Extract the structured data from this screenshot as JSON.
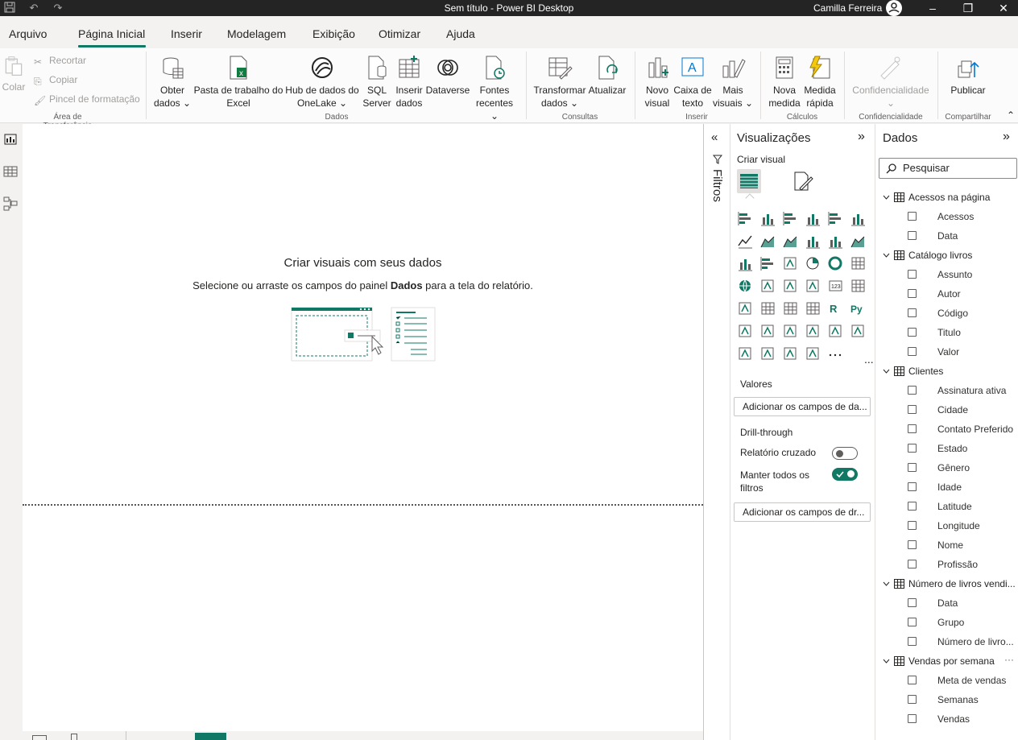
{
  "window": {
    "title": "Sem título - Power BI Desktop",
    "user": "Camilla Ferreira"
  },
  "menu": [
    "Arquivo",
    "Página Inicial",
    "Inserir",
    "Modelagem",
    "Exibição",
    "Otimizar",
    "Ajuda"
  ],
  "ribbon": {
    "clipboard": {
      "paste": "Colar",
      "cut": "Recortar",
      "copy": "Copiar",
      "format_painter": "Pincel de formatação",
      "label": "Área de Transferência"
    },
    "data": {
      "get_data": [
        "Obter",
        "dados"
      ],
      "excel": [
        "Pasta de trabalho do",
        "Excel"
      ],
      "onelake": [
        "Hub de dados do",
        "OneLake"
      ],
      "sql": [
        "SQL",
        "Server"
      ],
      "enter_data": [
        "Inserir",
        "dados"
      ],
      "dataverse": "Dataverse",
      "recent": [
        "Fontes",
        "recentes"
      ],
      "label": "Dados"
    },
    "queries": {
      "transform": [
        "Transformar",
        "dados"
      ],
      "refresh": "Atualizar",
      "label": "Consultas"
    },
    "insert": {
      "new_visual": [
        "Novo",
        "visual"
      ],
      "text_box": [
        "Caixa de",
        "texto"
      ],
      "more_visuals": [
        "Mais",
        "visuais"
      ],
      "label": "Inserir"
    },
    "calc": {
      "new_measure": [
        "Nova",
        "medida"
      ],
      "quick_measure": [
        "Medida",
        "rápida"
      ],
      "label": "Cálculos"
    },
    "sensitivity": {
      "button": "Confidencialidade",
      "label": "Confidencialidade"
    },
    "share": {
      "publish": "Publicar",
      "label": "Compartilhar"
    }
  },
  "canvas": {
    "heading": "Criar visuais com seus dados",
    "sub_before": "Selecione ou arraste os campos do painel ",
    "sub_bold": "Dados",
    "sub_after": " para a tela do relatório."
  },
  "filters": {
    "label": "Filtros"
  },
  "visualizations": {
    "title": "Visualizações",
    "create_visual": "Criar visual",
    "values_label": "Valores",
    "values_placeholder": "Adicionar os campos de da...",
    "drillthrough_label": "Drill-through",
    "cross_report_label": "Relatório cruzado",
    "cross_report_on": false,
    "keep_filters_label": [
      "Manter todos os",
      "filtros"
    ],
    "keep_filters_on": true,
    "drill_placeholder": "Adicionar os campos de dr...",
    "more": "..."
  },
  "data_pane": {
    "title": "Dados",
    "search_placeholder": "Pesquisar",
    "tables": [
      {
        "name": "Acessos na página",
        "fields": [
          "Acessos",
          "Data"
        ]
      },
      {
        "name": "Catálogo livros",
        "fields": [
          "Assunto",
          "Autor",
          "Código",
          "Titulo",
          "Valor"
        ]
      },
      {
        "name": "Clientes",
        "fields": [
          "Assinatura ativa",
          "Cidade",
          "Contato Preferido",
          "Estado",
          "Gênero",
          "Idade",
          "Latitude",
          "Longitude",
          "Nome",
          "Profissão"
        ]
      },
      {
        "name": "Número de livros vendi...",
        "fields": [
          "Data",
          "Grupo",
          "Número de livro..."
        ]
      },
      {
        "name": "Vendas por semana",
        "fields": [
          "Meta de vendas",
          "Semanas",
          "Vendas"
        ]
      }
    ]
  },
  "colors": {
    "accent": "#117865",
    "titlebar": "#242424"
  }
}
